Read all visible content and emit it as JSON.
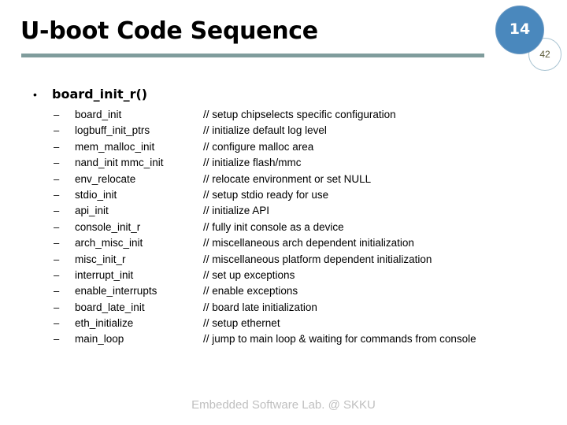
{
  "slide": {
    "title": "U-boot Code Sequence",
    "rule_color": "#7f9c9c",
    "footer": "Embedded Software Lab. @ SKKU"
  },
  "badges": {
    "primary": {
      "value": "14",
      "bg_color": "#4a88bd",
      "text_color": "#ffffff"
    },
    "secondary": {
      "value": "42",
      "border_color": "#a9c4d2",
      "text_color": "#5c5a38"
    }
  },
  "outline": {
    "level1_bullet": "•",
    "level1_label": "board_init_r()",
    "sub_dash": "–",
    "items": [
      {
        "name": "board_init",
        "comment": "// setup chipselects specific configuration"
      },
      {
        "name": "logbuff_init_ptrs",
        "comment": "// initialize default log level"
      },
      {
        "name": "mem_malloc_init",
        "comment": "// configure malloc area"
      },
      {
        "name": "nand_init mmc_init",
        "comment": "// initialize flash/mmc"
      },
      {
        "name": "env_relocate",
        "comment": "// relocate environment or set NULL"
      },
      {
        "name": "stdio_init",
        "comment": "// setup stdio ready for use"
      },
      {
        "name": "api_init",
        "comment": "// initialize API"
      },
      {
        "name": "console_init_r",
        "comment": "// fully init console as a device"
      },
      {
        "name": "arch_misc_init",
        "comment": "// miscellaneous arch dependent initialization"
      },
      {
        "name": "misc_init_r",
        "comment": "// miscellaneous platform dependent initialization"
      },
      {
        "name": "interrupt_init",
        "comment": "// set up exceptions"
      },
      {
        "name": "enable_interrupts",
        "comment": "// enable exceptions"
      },
      {
        "name": "board_late_init",
        "comment": "// board late initialization"
      },
      {
        "name": "eth_initialize",
        "comment": "// setup ethernet"
      },
      {
        "name": "main_loop",
        "comment": "// jump to main loop & waiting for commands from console"
      }
    ]
  }
}
